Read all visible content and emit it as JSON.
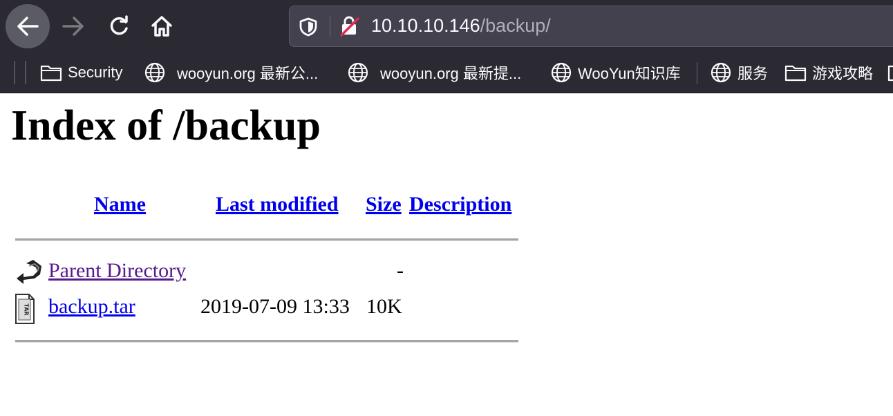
{
  "browser": {
    "url_host": "10.10.10.146",
    "url_path": "/backup/",
    "nav": {
      "back_icon": "arrow-left-icon",
      "forward_icon": "arrow-right-icon",
      "reload_icon": "reload-icon",
      "home_icon": "home-icon"
    },
    "bookmarks": [
      {
        "label": "Security",
        "icon": "folder-icon"
      },
      {
        "label": "wooyun.org 最新公...",
        "icon": "globe-icon"
      },
      {
        "label": "wooyun.org 最新提...",
        "icon": "globe-icon"
      },
      {
        "label": "WooYun知识库",
        "icon": "globe-icon"
      },
      {
        "label": "服务",
        "icon": "globe-icon"
      },
      {
        "label": "游戏攻略",
        "icon": "folder-icon"
      }
    ]
  },
  "page": {
    "title": "Index of /backup",
    "columns": {
      "name": "Name",
      "last_modified": "Last modified",
      "size": "Size",
      "description": "Description"
    },
    "rows": [
      {
        "name": "Parent Directory",
        "modified": "",
        "size": "-",
        "icon": "back-arrow-icon"
      },
      {
        "name": "backup.tar",
        "modified": "2019-07-09 13:33",
        "size": "10K",
        "icon": "tar-file-icon"
      }
    ]
  },
  "colors": {
    "toolbar_bg": "#2b2a33",
    "link": "#0000ee",
    "visited_link": "#551a8b"
  }
}
